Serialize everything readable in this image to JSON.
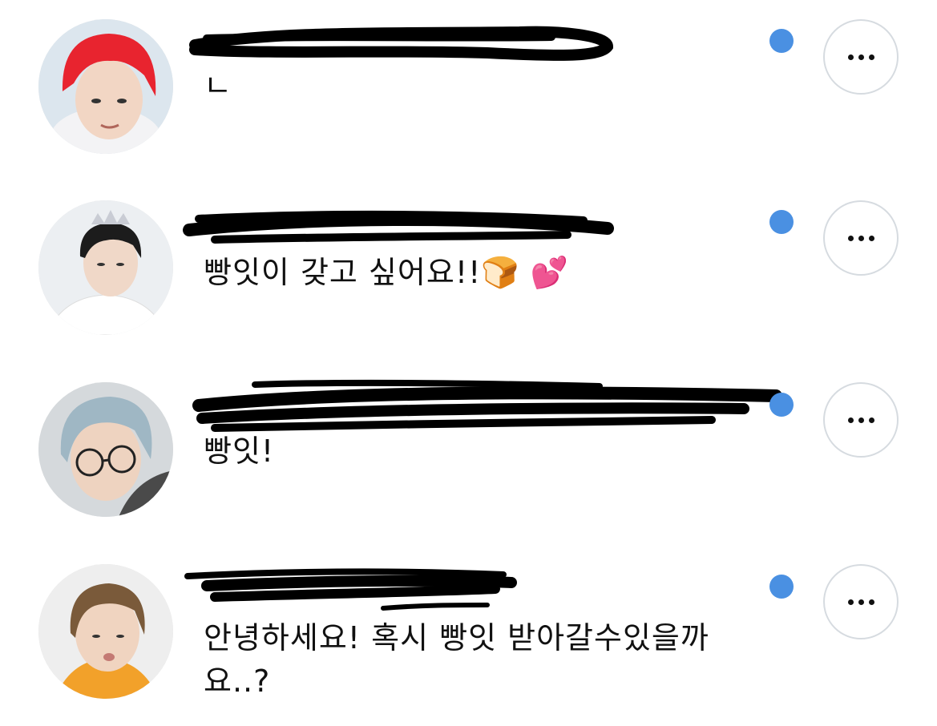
{
  "accent": "#4a90e2",
  "threads": [
    {
      "name": "",
      "message": "ㄴ",
      "unread": true,
      "avatar_hair": "#e8242f"
    },
    {
      "name": "",
      "message": "빵잇이 갖고 싶어요!!🍞 💕",
      "unread": true,
      "avatar_hair": "#1c1c1c"
    },
    {
      "name": "",
      "message": "빵잇!",
      "unread": true,
      "avatar_hair": "#9fb7c4"
    },
    {
      "name": "",
      "message": "안녕하세요! 혹시 빵잇 받아갈수있을까\n요..?",
      "unread": true,
      "avatar_hair": "#7a5a3a"
    }
  ],
  "icons": {
    "more": "more-horizontal-icon",
    "unread": "unread-dot-icon"
  }
}
